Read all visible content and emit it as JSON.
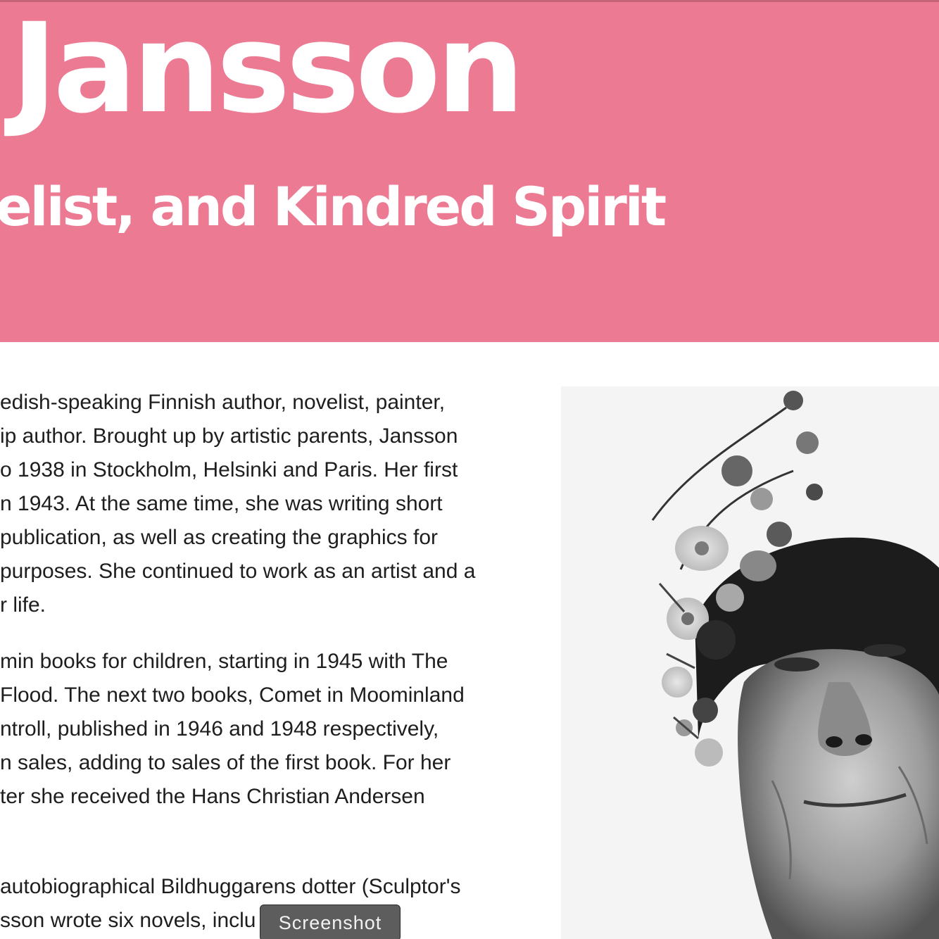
{
  "colors": {
    "hero_background": "#ec7a93",
    "hero_text": "#ffffff",
    "body_text": "#1e1e1e",
    "tooltip_background": "#5d5d5d"
  },
  "hero": {
    "title": "Jansson",
    "subtitle": "elist, and Kindred Spirit"
  },
  "paragraphs": [
    {
      "lines": [
        "edish-speaking Finnish author, novelist, painter,",
        "ip author. Brought up by artistic parents, Jansson",
        "o 1938 in Stockholm, Helsinki and Paris. Her first",
        "n 1943. At the same time, she was writing short",
        "publication, as well as creating the graphics for",
        "purposes. She continued to work as an artist and a",
        "r life."
      ]
    },
    {
      "lines": [
        "min books for children, starting in 1945 with The",
        " Flood. The next two books, Comet in Moominland",
        "ntroll, published in 1946 and 1948 respectively,",
        "n sales, adding to sales of the first book. For her",
        "ter she received the Hans Christian Andersen",
        ""
      ]
    },
    {
      "lines": [
        "autobiographical Bildhuggarens dotter (Sculptor's",
        "sson wrote six novels, inclu          ired"
      ]
    }
  ],
  "portrait": {
    "icon": "portrait-photo-flower-crown"
  },
  "tooltip": {
    "label": "Screenshot"
  }
}
